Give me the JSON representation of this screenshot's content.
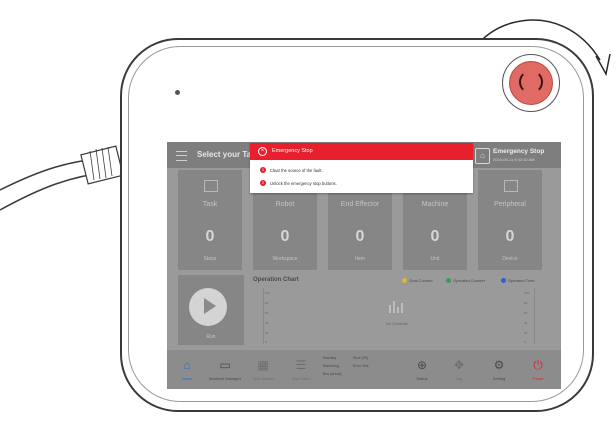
{
  "header": {
    "title": "Select your Ta",
    "status_title": "Emergency Stop",
    "timestamp": "2024-06-11 9:42:10 AM"
  },
  "dialog": {
    "title": "Emergency Stop",
    "steps": [
      {
        "num": "1",
        "text": "Clear the source of the fault."
      },
      {
        "num": "2",
        "text": "Unlock the emergency stop buttons."
      }
    ]
  },
  "cards": [
    {
      "label": "Task",
      "value": "0",
      "unit": "Steps"
    },
    {
      "label": "Robot",
      "value": "0",
      "unit": "Workspace"
    },
    {
      "label": "End Effector",
      "value": "0",
      "unit": "Item"
    },
    {
      "label": "Machine",
      "value": "0",
      "unit": "Unit"
    },
    {
      "label": "Peripheral",
      "value": "0",
      "unit": "Device"
    }
  ],
  "run": {
    "label": "Run"
  },
  "chart": {
    "title": "Operation Chart",
    "legend": [
      {
        "name": "Goal Counter",
        "color": "#e0b43a"
      },
      {
        "name": "Operated Counter",
        "color": "#3c9a52"
      },
      {
        "name": "Operated Time",
        "color": "#2f62c8"
      }
    ],
    "no_data": "No Contents",
    "y_ticks": [
      "100",
      "80",
      "60",
      "40",
      "20",
      "0"
    ]
  },
  "status": {
    "lines": [
      "Standby",
      "Mastering",
      "Bus (areas)"
    ],
    "lines2": [
      "Slow (95)",
      "Error Test"
    ]
  },
  "dock": [
    {
      "icon": "home-icon",
      "glyph": "⌂",
      "label": "Home"
    },
    {
      "icon": "workcell-icon",
      "glyph": "▭",
      "label": "Workcell Manager"
    },
    {
      "icon": "grid-icon",
      "glyph": "▦",
      "label": "Task Builder"
    },
    {
      "icon": "doc-icon",
      "glyph": "☰",
      "label": "Task Editor"
    },
    {
      "icon": "search-status-icon",
      "glyph": "⊕",
      "label": "Status"
    },
    {
      "icon": "jog-icon",
      "glyph": "✥",
      "label": "Jog"
    },
    {
      "icon": "gear-icon",
      "glyph": "⚙",
      "label": "Setting"
    },
    {
      "icon": "power-icon",
      "glyph": "⏻",
      "label": "Power"
    }
  ],
  "colors": {
    "accent": "#e8202e",
    "home_active": "#1f6fd1",
    "power": "#e8202e"
  }
}
